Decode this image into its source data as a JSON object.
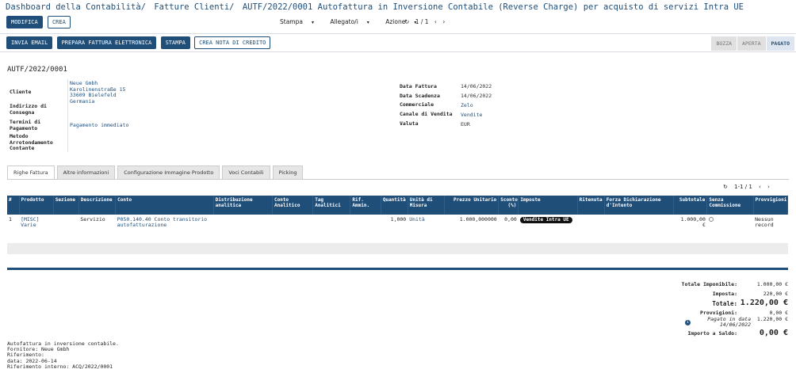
{
  "breadcrumb": [
    "Dashboard della Contabilità",
    "Fatture Clienti",
    "AUTF/2022/0001 Autofattura in Inversione Contabile (Reverse Charge) per acquisto di servizi Intra UE"
  ],
  "breadcrumb_sep": "/",
  "actions": {
    "edit": "MODIFICA",
    "create": "CREA"
  },
  "menu": {
    "print": "Stampa",
    "attachments": "Allegato/i",
    "action": "Azione"
  },
  "pager_top": "1 / 1",
  "buttons": {
    "send_email": "INVIA EMAIL",
    "prepare_einvoice": "PREPARA FATTURA ELETTRONICA",
    "print": "STAMPA",
    "credit_note": "CREA NOTA DI CREDITO"
  },
  "status": [
    "BOZZA",
    "APERTA",
    "PAGATO"
  ],
  "doc_name": "AUTF/2022/0001",
  "left_fields": {
    "customer_label": "Cliente",
    "customer_lines": [
      "Neue Gmbh",
      "Karolinenstraße 15",
      "33609 Bielefeld",
      "Germania"
    ],
    "delivery_label_1": "Indirizzo di",
    "delivery_label_2": "Consegna",
    "terms_label_1": "Termini di",
    "terms_label_2": "Pagamento",
    "terms_value": "Pagamento immediato",
    "rounding_label_1": "Metodo",
    "rounding_label_2": "Arrotondamento",
    "rounding_label_3": "Contante"
  },
  "right_fields": [
    {
      "label": "Data Fattura",
      "value": "14/06/2022"
    },
    {
      "label": "Data Scadenza",
      "value": "14/06/2022"
    },
    {
      "label": "Commerciale",
      "value": "Zelo"
    },
    {
      "label": "Canale di Vendita",
      "value": "Vendite"
    },
    {
      "label": "Valuta",
      "value": "EUR"
    }
  ],
  "tabs": [
    "Righe Fattura",
    "Altre informazioni",
    "Configurazione Immagine Prodotto",
    "Voci Contabili",
    "Picking"
  ],
  "pager_lines": "1-1 / 1",
  "table": {
    "headers": [
      "#",
      "Prodotto",
      "Sezione",
      "Descrizione",
      "Conto",
      "Distribuzione analitica",
      "Conto Analitico",
      "Tag Analitici",
      "Rif. Ammin.",
      "Quantità",
      "Unità di Misura",
      "Prezzo Unitario",
      "Sconto (%)",
      "Imposte",
      "Ritenuta",
      "Forza Dichiarazione d'Intento",
      "Subtotale",
      "Senza Commissione",
      "Provvigioni"
    ],
    "row": {
      "num": "1",
      "product": "[MISC] Varie",
      "description": "Servizio",
      "account": "P050.140.40 Conto transitorio autofatturazione",
      "quantity": "1,000",
      "uom": "Unità",
      "price": "1.000,000000",
      "discount": "0,00",
      "tax": "Vendite Intra UE",
      "subtotal": "1.000,00 €",
      "commission": "Nessun record"
    }
  },
  "totals": {
    "taxable_label": "Totale Imponibile:",
    "taxable": "1.000,00 €",
    "tax_label": "Imposta:",
    "tax": "220,00 €",
    "total_label": "Totale:",
    "total": "1.220,00 €",
    "commission_label": "Provvigioni:",
    "commission": "0,00 €",
    "paid_label": "Pagato in data 14/06/2022",
    "paid": "1.220,00 €",
    "balance_label": "Importo a Saldo:",
    "balance": "0,00 €"
  },
  "notes": "Autofattura in inversione contabile.\nFornitore: Neue Gmbh\nRiferimento:\ndata: 2022-06-14\nRiferimento interno: ACQ/2022/0001",
  "colors": {
    "primary": "#1f4e79",
    "badge": "#111111"
  }
}
